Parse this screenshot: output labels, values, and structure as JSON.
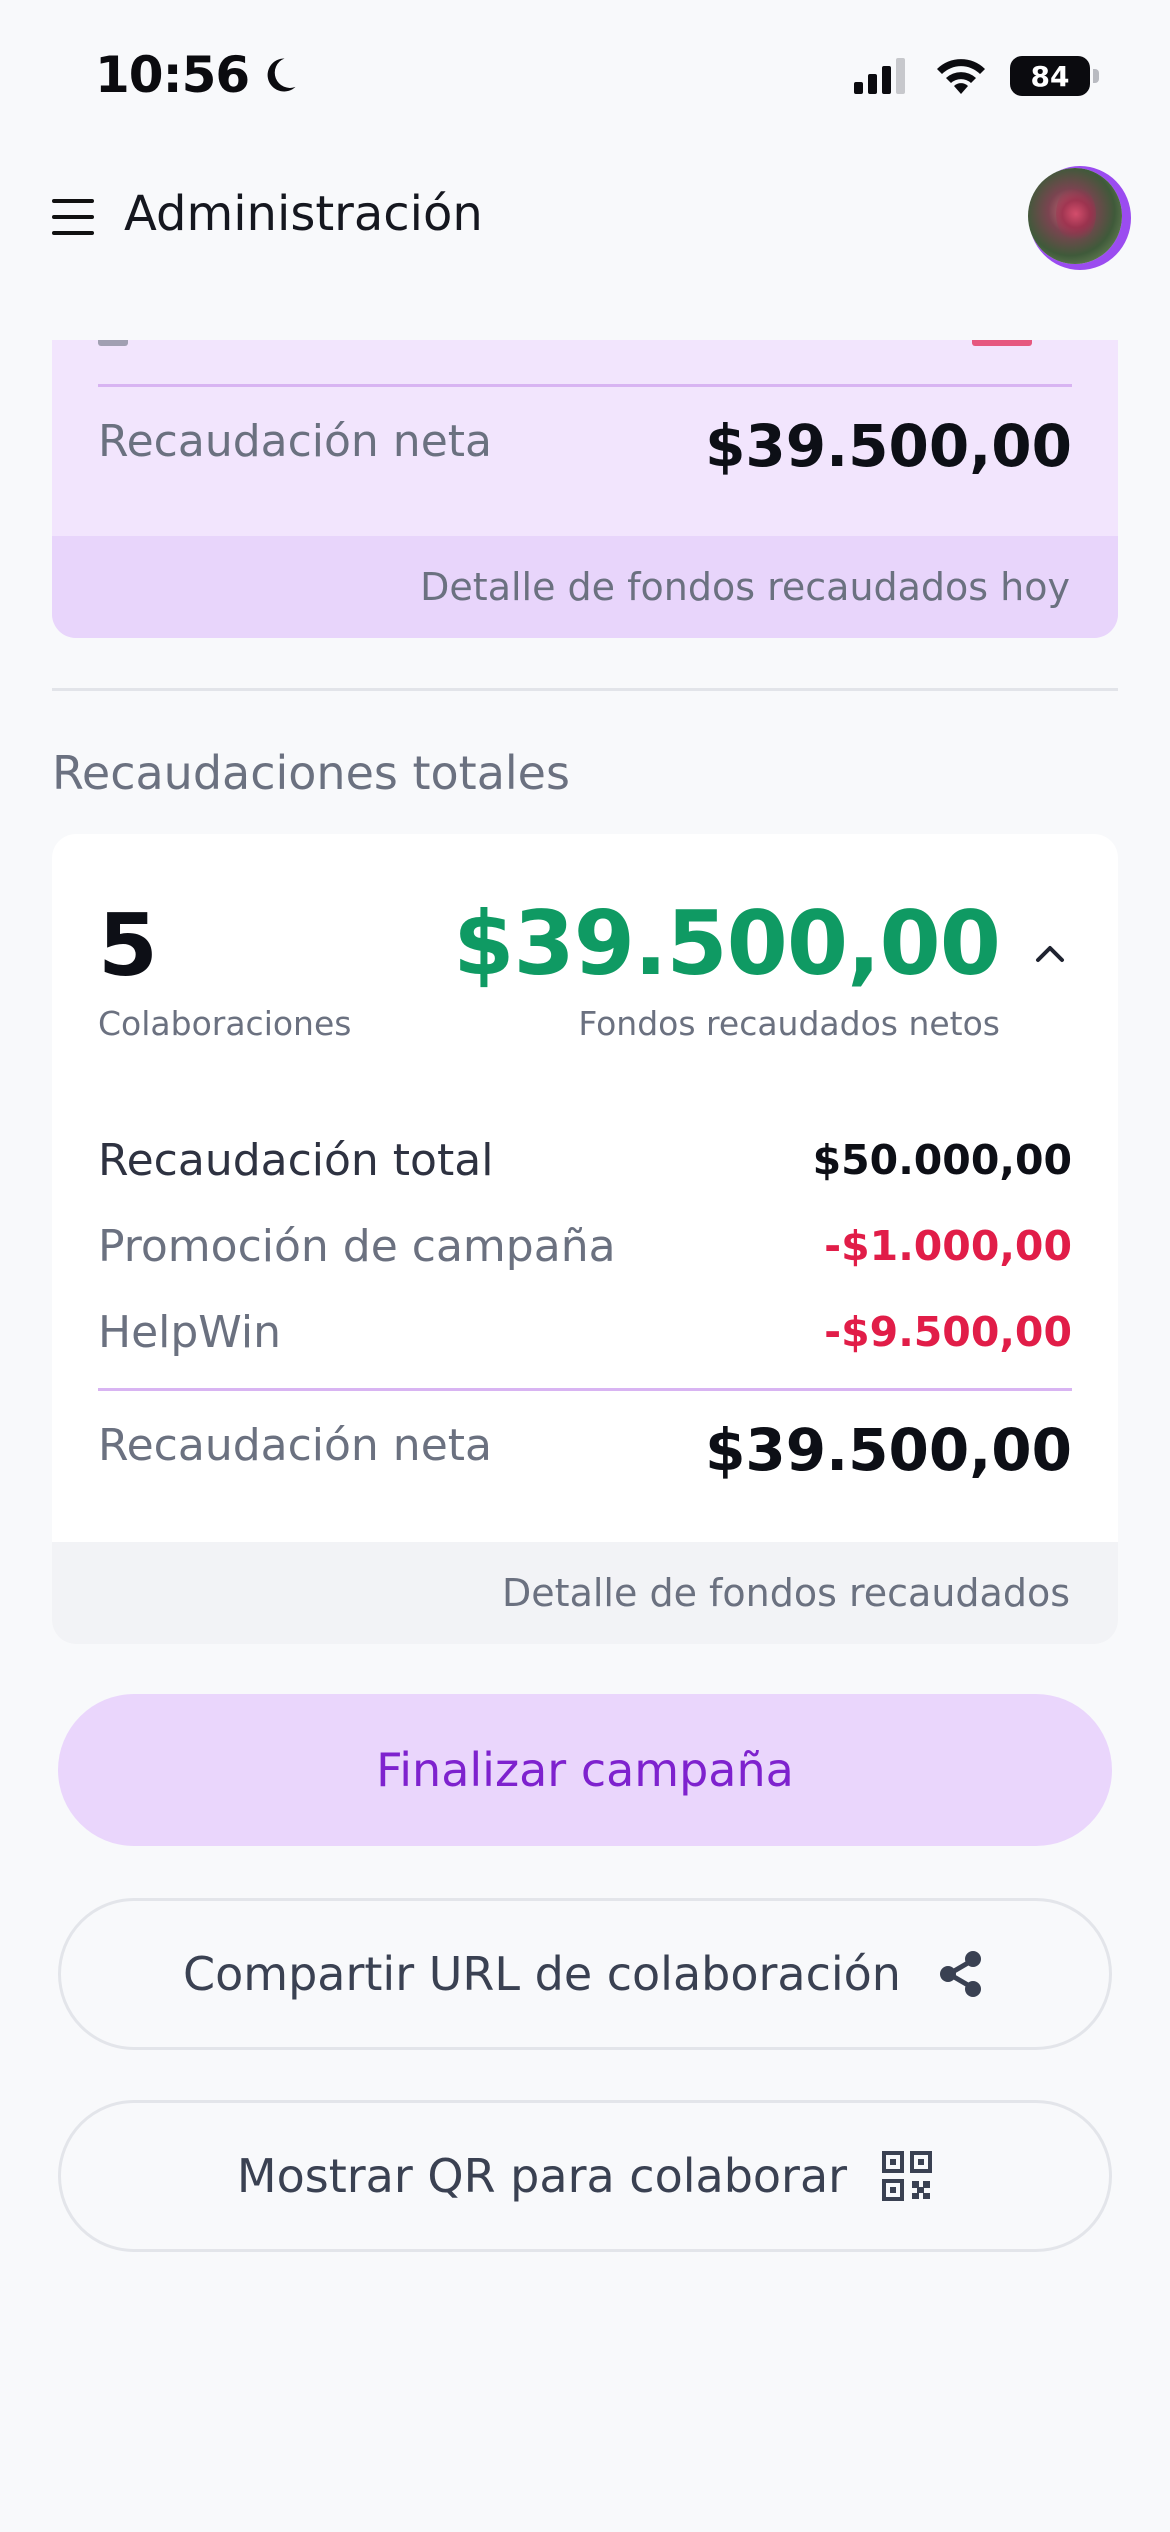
{
  "status_bar": {
    "time": "10:56",
    "battery": "84",
    "icons": [
      "moon-icon",
      "signal-icon",
      "wifi-icon",
      "battery-icon"
    ]
  },
  "header": {
    "title": "Administración",
    "menu_icon": "hamburger-menu-icon",
    "avatar": "user-avatar"
  },
  "today_card": {
    "net_label": "Recaudación neta",
    "net_value": "$39.500,00",
    "footer_link": "Detalle de fondos recaudados hoy"
  },
  "totals": {
    "section_title": "Recaudaciones totales",
    "count": "5",
    "count_label": "Colaboraciones",
    "net_value": "$39.500,00",
    "net_label": "Fondos recaudados netos",
    "rows": [
      {
        "label": "Recaudación total",
        "value": "$50.000,00"
      },
      {
        "label": "Promoción de campaña",
        "value": "-$1.000,00"
      },
      {
        "label": "HelpWin",
        "value": "-$9.500,00"
      }
    ],
    "net_row_label": "Recaudación neta",
    "net_row_value": "$39.500,00",
    "footer_link": "Detalle de fondos recaudados"
  },
  "actions": {
    "finish": "Finalizar campaña",
    "share": "Compartir URL de colaboración",
    "qr": "Mostrar QR para colaborar"
  },
  "colors": {
    "accent_purple": "#7e22ce",
    "positive_green": "#0f9a63",
    "negative_red": "#e11d48",
    "card_lavender": "#f2e5fd"
  }
}
